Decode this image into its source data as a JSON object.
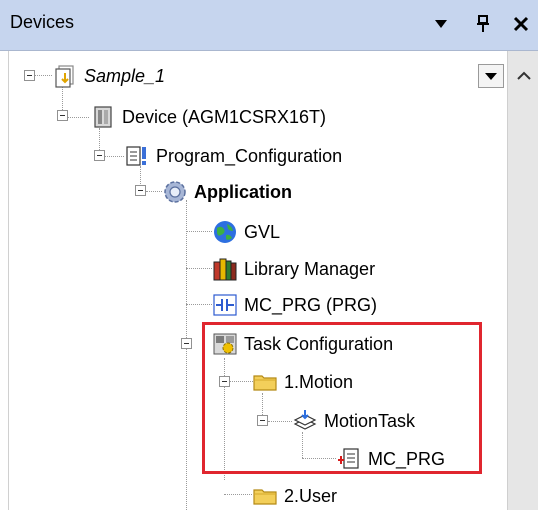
{
  "panel": {
    "title": "Devices",
    "menu_icon": "dropdown-arrow-icon",
    "pin_icon": "pin-icon",
    "close_icon": "close-icon"
  },
  "tree": {
    "root": "Sample_1",
    "device": "Device (AGM1CSRX16T)",
    "program_configuration": "Program_Configuration",
    "application": "Application",
    "gvl": "GVL",
    "library_manager": "Library Manager",
    "mc_prg": "MC_PRG (PRG)",
    "task_configuration": "Task Configuration",
    "motion_folder": "1.Motion",
    "motion_task": "MotionTask",
    "motion_task_call": "MC_PRG",
    "user_folder": "2.User"
  },
  "colors": {
    "titlebar": "#c6d5ee",
    "highlight": "#e0262f"
  }
}
